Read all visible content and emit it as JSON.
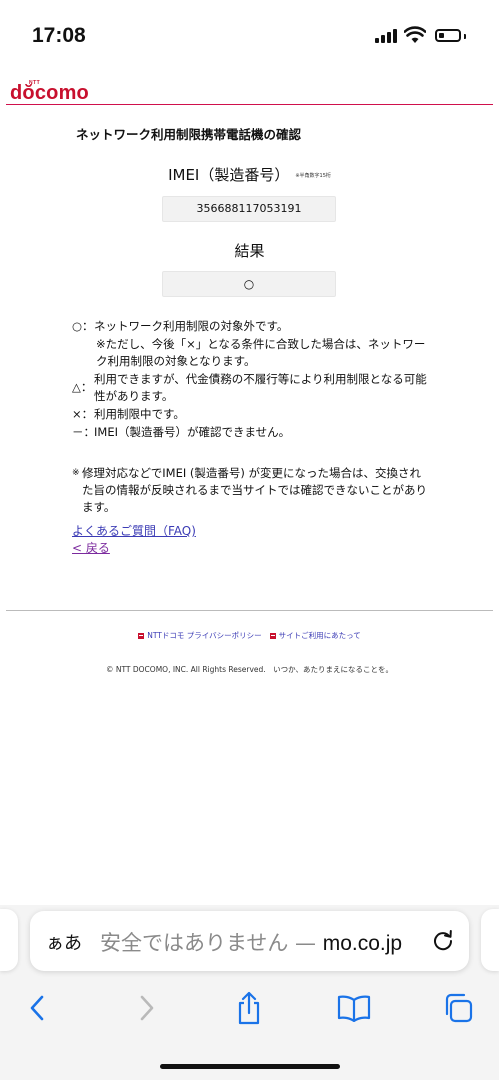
{
  "status_bar": {
    "time": "17:08",
    "battery_level": 0.3
  },
  "brand": {
    "ntt": "NTT",
    "logo": "dŏcomo",
    "color": "#c8102e"
  },
  "page": {
    "title": "ネットワーク利用制限携帯電話機の確認",
    "imei_label": "IMEI（製造番号）",
    "imei_note": "※半角数字15桁",
    "imei_value": "356688117053191",
    "result_label": "結果",
    "result_value": "○"
  },
  "legend": [
    {
      "symbol": "○：",
      "text": "ネットワーク利用制限の対象外です。"
    },
    {
      "symbol": "",
      "text": "※ただし、今後「×」となる条件に合致した場合は、ネットワーク利用制限の対象となります。"
    },
    {
      "symbol": "△：",
      "text": "利用できますが、代金債務の不履行等により利用制限となる可能性があります。"
    },
    {
      "symbol": "×：",
      "text": "利用制限中です。"
    },
    {
      "symbol": "－：",
      "text": "IMEI（製造番号）が確認できません。"
    }
  ],
  "notice": {
    "mark": "※",
    "text": "修理対応などでIMEI (製造番号) が変更になった場合は、交換された旨の情報が反映されるまで当サイトでは確認できないことがあります。"
  },
  "links": {
    "faq": "よくあるご質問（FAQ)",
    "back": "< 戻る"
  },
  "footer": {
    "privacy": "NTTドコモ プライバシーポリシー",
    "terms": "サイトご利用にあたって",
    "copyright": "© NTT DOCOMO, INC. All Rights Reserved.　いつか、あたりまえになることを。"
  },
  "browser": {
    "aa_label": "ぁあ",
    "url_prefix": "安全ではありません — ",
    "url_domain": "mo.co.jp",
    "icons": [
      "back-icon",
      "forward-icon",
      "share-icon",
      "bookmarks-icon",
      "tabs-icon",
      "reload-icon"
    ]
  }
}
